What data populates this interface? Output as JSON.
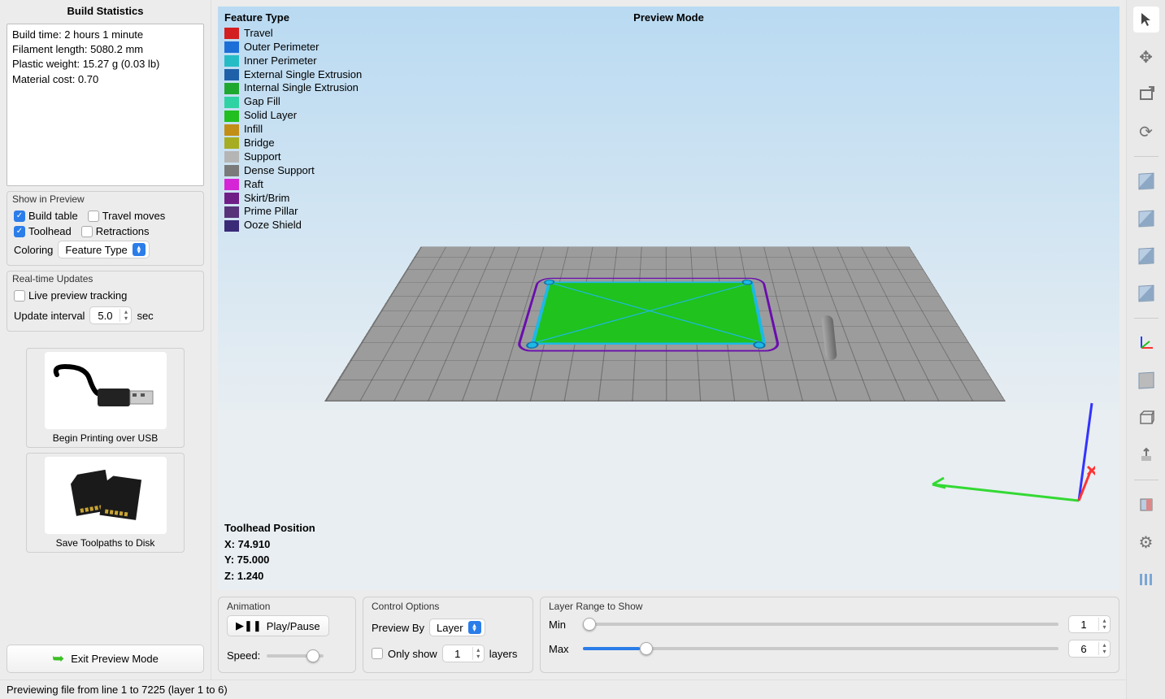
{
  "sidebar": {
    "stats_title": "Build Statistics",
    "stats_lines": "Build time: 2 hours 1 minute\nFilament length: 5080.2 mm\nPlastic weight: 15.27 g (0.03 lb)\nMaterial cost: 0.70",
    "show_in_preview_title": "Show in Preview",
    "chk_build_table": "Build table",
    "chk_travel_moves": "Travel moves",
    "chk_toolhead": "Toolhead",
    "chk_retractions": "Retractions",
    "coloring_label": "Coloring",
    "coloring_value": "Feature Type",
    "realtime_title": "Real-time Updates",
    "chk_live_preview": "Live preview tracking",
    "update_interval_label": "Update interval",
    "update_interval_value": "5.0",
    "update_interval_unit": "sec",
    "usb_caption": "Begin Printing over USB",
    "disk_caption": "Save Toolpaths to Disk",
    "exit_label": "Exit Preview Mode"
  },
  "legend": {
    "title": "Feature Type",
    "items": [
      {
        "label": "Travel",
        "color": "#d31f1f"
      },
      {
        "label": "Outer Perimeter",
        "color": "#1d6fd8"
      },
      {
        "label": "Inner Perimeter",
        "color": "#25bcc6"
      },
      {
        "label": "External Single Extrusion",
        "color": "#1f61a8"
      },
      {
        "label": "Internal Single Extrusion",
        "color": "#1fa82f"
      },
      {
        "label": "Gap Fill",
        "color": "#2fd2a2"
      },
      {
        "label": "Solid Layer",
        "color": "#21bf20"
      },
      {
        "label": "Infill",
        "color": "#c28e16"
      },
      {
        "label": "Bridge",
        "color": "#a6ad22"
      },
      {
        "label": "Support",
        "color": "#b5b5b5"
      },
      {
        "label": "Dense Support",
        "color": "#7a7a7a"
      },
      {
        "label": "Raft",
        "color": "#d625d6"
      },
      {
        "label": "Skirt/Brim",
        "color": "#6f1e87"
      },
      {
        "label": "Prime Pillar",
        "color": "#58337a"
      },
      {
        "label": "Ooze Shield",
        "color": "#3a2a78"
      }
    ]
  },
  "viewport": {
    "title": "Preview Mode",
    "toolhead_header": "Toolhead Position",
    "toolhead_x": "X: 74.910",
    "toolhead_y": "Y: 75.000",
    "toolhead_z": "Z: 1.240"
  },
  "controls": {
    "animation_title": "Animation",
    "play_pause": "Play/Pause",
    "speed_label": "Speed:",
    "control_options_title": "Control Options",
    "preview_by_label": "Preview By",
    "preview_by_value": "Layer",
    "only_show_label": "Only show",
    "only_show_value": "1",
    "layers_suffix": "layers",
    "layer_range_title": "Layer Range to Show",
    "min_label": "Min",
    "min_value": "1",
    "max_label": "Max",
    "max_value": "6"
  },
  "statusbar": "Previewing file from line 1 to 7225 (layer 1 to 6)"
}
